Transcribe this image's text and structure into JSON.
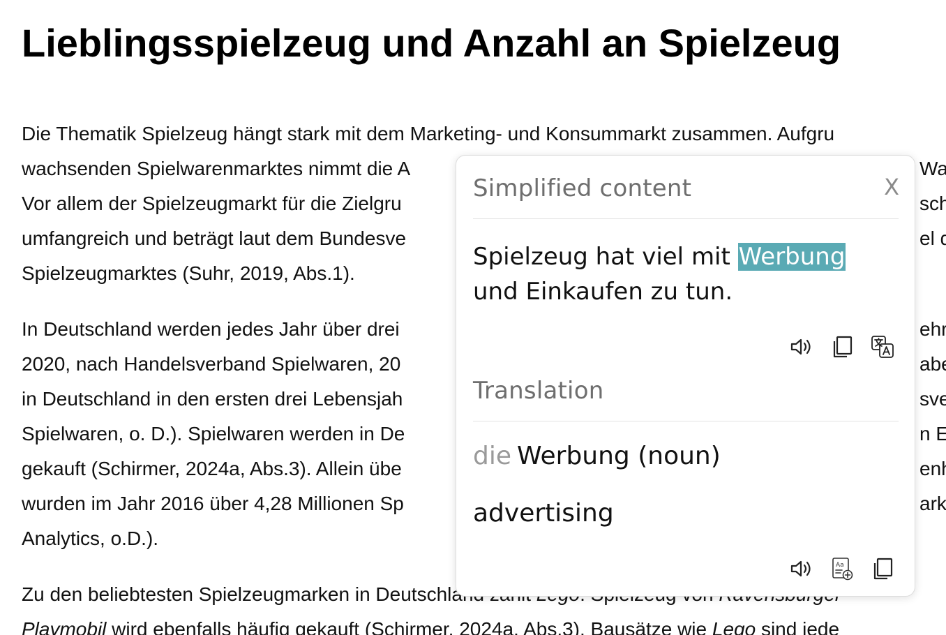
{
  "article": {
    "title": "Lieblingsspielzeug und Anzahl an Spielzeug",
    "p1": [
      "Die Thematik Spielzeug hängt stark mit dem Marketing- und Konsummarkt zusammen. Aufgru",
      "wachsenden Spielwarenmarktes nimmt die A",
      "Vor allem der Spielzeugmarkt für die Zielgru",
      "umfangreich und beträgt laut dem Bundesve",
      "Spielzeugmarktes (Suhr, 2019, Abs.1)."
    ],
    "p1_right": [
      "",
      "Wab",
      "sch",
      "el d",
      ""
    ],
    "p2": [
      "In Deutschland werden jedes Jahr über drei",
      "2020, nach Handelsverband Spielwaren, 20",
      "in Deutschland in den ersten drei Lebensjah",
      "Spielwaren, o. D.). Spielwaren werden in De",
      "gekauft (Schirmer, 2024a, Abs.3). Allein übe",
      "wurden im Jahr 2016 über 4,28 Millionen Sp",
      "Analytics, o.D.)."
    ],
    "p2_right": [
      "ehrin",
      "abe",
      "sver",
      "n E",
      "enha",
      "ark",
      ""
    ],
    "p3_line1_pre": "Zu den beliebtesten Spielzeugmarken in Deutschland zählt ",
    "p3_line1_italic": "Lego",
    "p3_line1_post": ". Spielzeug von ",
    "p3_line1_italic2": "Ravensburger",
    "p3_line2_italic": "Playmobil",
    "p3_line2_mid": " wird ebenfalls häufig gekauft (Schirmer, 2024a, Abs.3). Bausätze wie ",
    "p3_line2_italic2": "Lego",
    "p3_line2_post": " sind jede"
  },
  "popup": {
    "simplified_title": "Simplified content",
    "close_label": "X",
    "simplified_pre": "Spielzeug hat viel mit ",
    "simplified_highlight": "Werbung",
    "simplified_post": " und Einkaufen zu tun.",
    "translation_title": "Translation",
    "word_article": "die",
    "word": "Werbung (noun)",
    "meaning": "advertising",
    "icons_top": [
      "speaker-icon",
      "copy-icon",
      "translate-icon"
    ],
    "icons_bottom": [
      "speaker-icon",
      "add-vocabulary-icon",
      "copy-icon"
    ],
    "highlight_color": "#5aaab4"
  }
}
